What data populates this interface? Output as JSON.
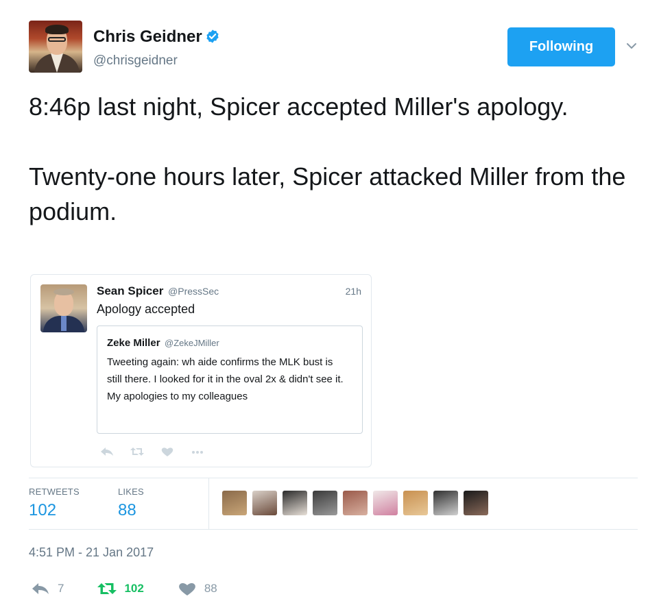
{
  "author": {
    "name": "Chris Geidner",
    "handle": "@chrisgeidner",
    "verified": true,
    "follow_label": "Following"
  },
  "tweet": {
    "paragraphs": [
      "8:46p last night, Spicer accepted Miller's apology.",
      "Twenty-one hours later, Spicer attacked Miller from the podium."
    ]
  },
  "quoted": {
    "name": "Sean Spicer",
    "handle": "@PressSec",
    "time": "21h",
    "text": "Apology accepted",
    "inner": {
      "name": "Zeke Miller",
      "handle": "@ZekeJMiller",
      "text": "Tweeting again: wh aide confirms the MLK bust is still there. I looked for it in the oval 2x & didn't see it. My apologies to my colleagues"
    },
    "actions": [
      "reply-icon",
      "retweet-icon",
      "like-icon",
      "more-icon"
    ]
  },
  "stats": {
    "retweets_label": "RETWEETS",
    "retweets": "102",
    "likes_label": "LIKES",
    "likes": "88",
    "likers": [
      {
        "colors": [
          "#8a6a4a",
          "#c9a678"
        ]
      },
      {
        "colors": [
          "#d9d0c8",
          "#6a4a3a"
        ]
      },
      {
        "colors": [
          "#2a2a2a",
          "#e8e0d8"
        ]
      },
      {
        "colors": [
          "#3a3a3a",
          "#9a9a9a"
        ]
      },
      {
        "colors": [
          "#9a5a4a",
          "#d8b0a0"
        ]
      },
      {
        "colors": [
          "#f0e8e8",
          "#d080a0"
        ]
      },
      {
        "colors": [
          "#c89050",
          "#e8c898"
        ]
      },
      {
        "colors": [
          "#303030",
          "#d0d0d0"
        ]
      },
      {
        "colors": [
          "#1a1a1a",
          "#8a6a5a"
        ]
      }
    ]
  },
  "timestamp": "4:51 PM - 21 Jan 2017",
  "actions": {
    "reply_count": "7",
    "retweet_count": "102",
    "like_count": "88"
  },
  "colors": {
    "accent": "#1da1f2",
    "retweet_green": "#17bf63",
    "muted": "#657786"
  }
}
